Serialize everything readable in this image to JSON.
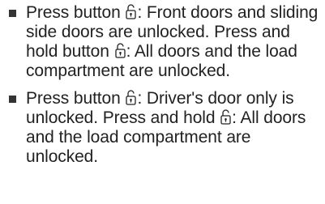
{
  "colors": {
    "text": "#222222",
    "bullet": "#333333",
    "background": "#ffffff"
  },
  "icons": {
    "unlock": "unlock-button-icon"
  },
  "bullets": [
    {
      "seg1": "Press button ",
      "seg2": ": Front doors and sliding side doors are unlocked. Press and hold button ",
      "seg3": ": All doors and the load compartment are unlocked."
    },
    {
      "seg1": "Press button ",
      "seg2": ": Driver's door only is unlocked. Press and hold ",
      "seg3": ": All doors and the load compartment are unlocked."
    }
  ]
}
